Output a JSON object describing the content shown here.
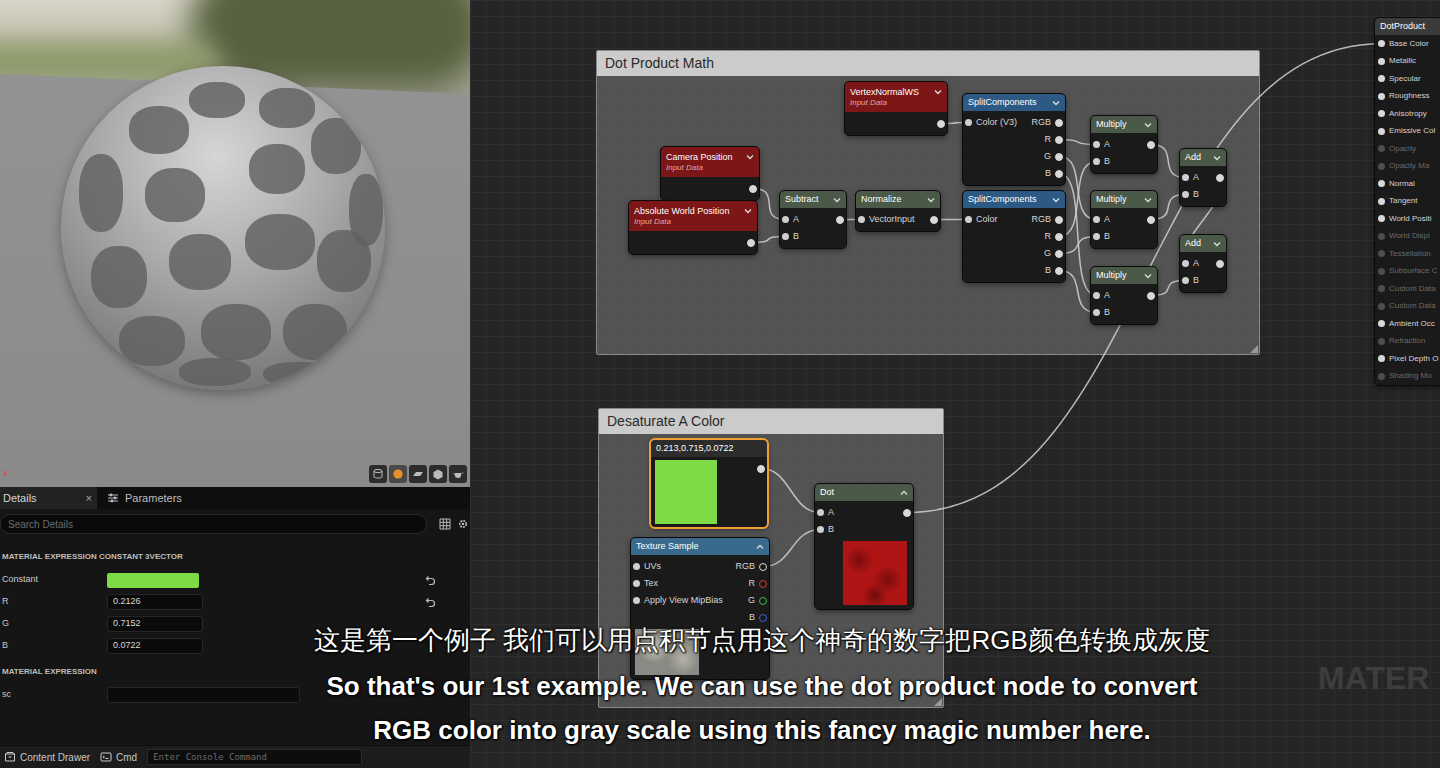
{
  "viewport": {
    "axis": "x",
    "toolbar": [
      {
        "selected": false
      },
      {
        "selected": true
      },
      {
        "selected": false
      },
      {
        "selected": false
      },
      {
        "selected": false
      }
    ]
  },
  "details": {
    "tabs": [
      {
        "label": "Details",
        "close": "×",
        "selected": true
      },
      {
        "label": "Parameters",
        "selected": false
      }
    ],
    "search": {
      "placeholder": "Search Details"
    },
    "sections": [
      {
        "title": "MATERIAL EXPRESSION CONSTANT 3VECTOR",
        "rows": [
          {
            "kind": "color",
            "label": "Constant",
            "color": "#7ddc45",
            "reset": true
          },
          {
            "kind": "number",
            "label": "R",
            "value": "0.2126",
            "reset": true
          },
          {
            "kind": "number",
            "label": "G",
            "value": "0.7152",
            "reset": false
          },
          {
            "kind": "number",
            "label": "B",
            "value": "0.0722",
            "reset": false
          }
        ]
      },
      {
        "title": "MATERIAL EXPRESSION",
        "rows": [
          {
            "kind": "text",
            "label": "sc",
            "reset": false
          }
        ]
      }
    ]
  },
  "status_bar": {
    "content_drawer": "Content Drawer",
    "cmd": "Cmd",
    "console": {
      "placeholder": "Enter Console Command"
    }
  },
  "graph": {
    "comments": [
      {
        "title": "Dot Product Math"
      },
      {
        "title": "Desaturate A Color"
      }
    ],
    "nodes": [
      {
        "kind": "input",
        "title": "Camera Position",
        "subtitle": "Input Data",
        "inputs": [],
        "outputs": [],
        "unnamed_output": true,
        "selected": false
      },
      {
        "kind": "input",
        "title": "Absolute World Position",
        "subtitle": "Input Data",
        "inputs": [],
        "outputs": [],
        "unnamed_output": true,
        "selected": false
      },
      {
        "kind": "input",
        "title": "VertexNormalWS",
        "subtitle": "Input Data",
        "inputs": [],
        "outputs": [],
        "unnamed_output": true,
        "selected": false
      },
      {
        "kind": "math",
        "title": "Subtract",
        "inputs": [
          "A",
          "B"
        ],
        "outputs": [],
        "unnamed_output": true,
        "selected": false
      },
      {
        "kind": "math",
        "title": "Normalize",
        "inputs": [
          "VectorInput"
        ],
        "outputs": [],
        "unnamed_output": true,
        "selected": false
      },
      {
        "kind": "split",
        "title": "SplitComponents",
        "inputs": [
          "Color (V3)"
        ],
        "outputs": [
          "RGB",
          "R",
          "G",
          "B"
        ],
        "unnamed_output": false,
        "selected": false
      },
      {
        "kind": "split",
        "title": "SplitComponents",
        "inputs": [
          "Color"
        ],
        "outputs": [
          "RGB",
          "R",
          "G",
          "B"
        ],
        "unnamed_output": false,
        "selected": false
      },
      {
        "kind": "math",
        "title": "Multiply",
        "inputs": [
          "A",
          "B"
        ],
        "outputs": [],
        "unnamed_output": true,
        "selected": false
      },
      {
        "kind": "math",
        "title": "Multiply",
        "inputs": [
          "A",
          "B"
        ],
        "outputs": [],
        "unnamed_output": true,
        "selected": false
      },
      {
        "kind": "math",
        "title": "Multiply",
        "inputs": [
          "A",
          "B"
        ],
        "outputs": [],
        "unnamed_output": true,
        "selected": false
      },
      {
        "kind": "math",
        "title": "Add",
        "inputs": [
          "A",
          "B"
        ],
        "outputs": [],
        "unnamed_output": true,
        "selected": false
      },
      {
        "kind": "math",
        "title": "Add",
        "inputs": [
          "A",
          "B"
        ],
        "outputs": [],
        "unnamed_output": true,
        "selected": false
      },
      {
        "kind": "constant",
        "title": "0.213,0.715,0.0722",
        "color": "#7ddc45",
        "inputs": [],
        "outputs": [],
        "unnamed_output": true,
        "selected": true
      },
      {
        "kind": "texture",
        "title": "Texture Sample",
        "inputs": [
          "UVs",
          "Tex",
          "Apply View MipBias"
        ],
        "outputs": [
          "RGB",
          "R",
          "G",
          "B"
        ],
        "output_colors": [
          "#d8d8d8",
          "#d23a3a",
          "#3fbf3f",
          "#3a62e0"
        ],
        "unnamed_output": false,
        "selected": false
      },
      {
        "kind": "dot",
        "title": "Dot",
        "inputs": [
          "A",
          "B"
        ],
        "outputs": [],
        "unnamed_output": true,
        "selected": false
      }
    ],
    "output": {
      "title": "DotProduct",
      "pins": [
        {
          "label": "Base Color",
          "enabled": true
        },
        {
          "label": "Metallic",
          "enabled": true
        },
        {
          "label": "Specular",
          "enabled": true
        },
        {
          "label": "Roughness",
          "enabled": true
        },
        {
          "label": "Anisotropy",
          "enabled": true
        },
        {
          "label": "Emissive Col",
          "enabled": true
        },
        {
          "label": "Opacity",
          "enabled": false
        },
        {
          "label": "Opacity Ma",
          "enabled": false
        },
        {
          "label": "Normal",
          "enabled": true
        },
        {
          "label": "Tangent",
          "enabled": true
        },
        {
          "label": "World Positi",
          "enabled": true
        },
        {
          "label": "World Displ",
          "enabled": false
        },
        {
          "label": "Tessellation",
          "enabled": false
        },
        {
          "label": "Subsurface C",
          "enabled": false
        },
        {
          "label": "Custom Data",
          "enabled": false
        },
        {
          "label": "Custom Data",
          "enabled": false
        },
        {
          "label": "Ambient Occ",
          "enabled": true
        },
        {
          "label": "Refraction",
          "enabled": false
        },
        {
          "label": "Pixel Depth O",
          "enabled": true
        },
        {
          "label": "Shading Mo",
          "enabled": false
        }
      ]
    }
  },
  "watermark": "MATER",
  "subtitles": {
    "zh": "这是第一个例子 我们可以用点积节点用这个神奇的数字把RGB颜色转换成灰度",
    "en": [
      "So that's our 1st example. We can use the dot product node to convert",
      "RGB color into gray scale using this fancy magic number here."
    ]
  }
}
